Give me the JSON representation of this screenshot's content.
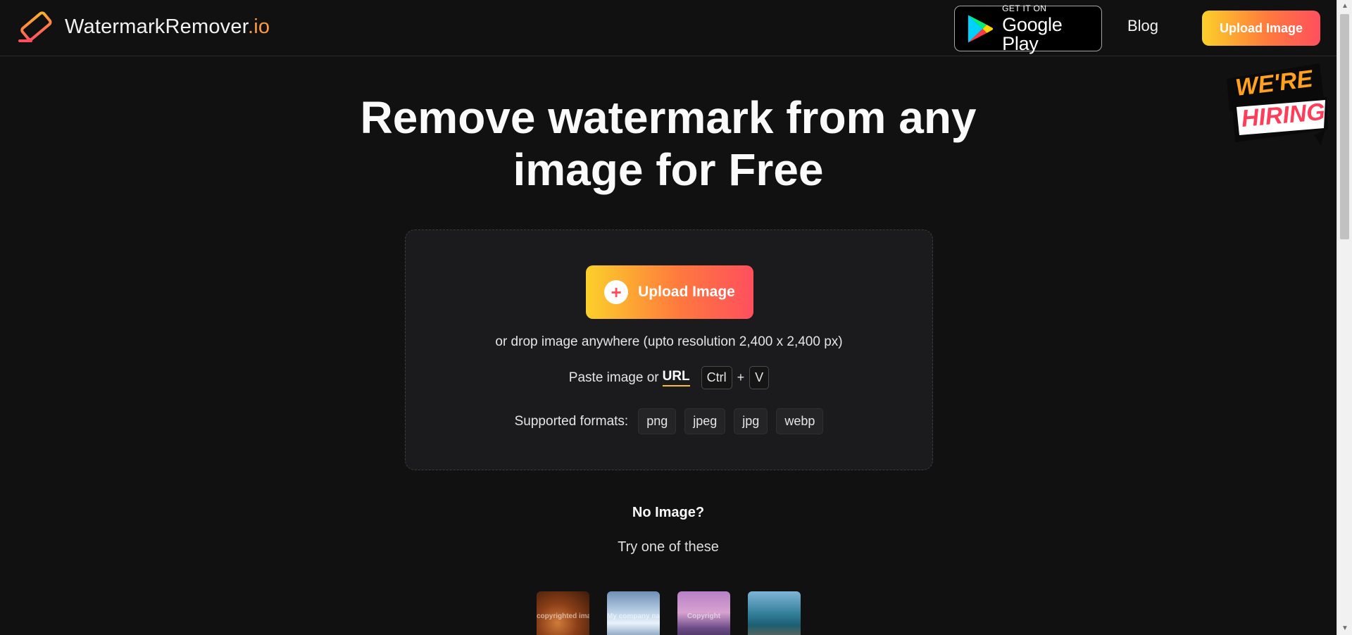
{
  "header": {
    "logo_name": "WatermarkRemover",
    "logo_tld": ".io",
    "google_play": {
      "small": "GET IT ON",
      "big": "Google Play"
    },
    "blog_label": "Blog",
    "upload_label": "Upload Image"
  },
  "hiring_badge": {
    "line1": "WE'RE",
    "line2": "HIRING"
  },
  "hero": {
    "title_line1": "Remove watermark from any",
    "title_line2": "image for Free"
  },
  "upload_card": {
    "button_label": "Upload Image",
    "drop_text": "or drop image anywhere (upto resolution 2,400 x 2,400 px)",
    "paste_text": "Paste image or",
    "url_label": "URL",
    "key_ctrl": "Ctrl",
    "key_plus": "+",
    "key_v": "V",
    "formats_label": "Supported formats:",
    "formats": [
      "png",
      "jpeg",
      "jpg",
      "webp"
    ]
  },
  "samples": {
    "heading": "No Image?",
    "subheading": "Try one of these",
    "items": [
      {
        "watermark": "copyrighted image"
      },
      {
        "watermark": "My company na"
      },
      {
        "watermark": "Copyright"
      },
      {
        "watermark": ""
      }
    ]
  },
  "colors": {
    "background": "#111112",
    "card": "#1b1b1d",
    "gradient_start": "#fcd02a",
    "gradient_end": "#ff4f5e",
    "accent_underline": "#fcbf2a"
  },
  "icons": [
    "eraser-logo-icon",
    "google-play-icon",
    "plus-icon",
    "hiring-badge"
  ]
}
